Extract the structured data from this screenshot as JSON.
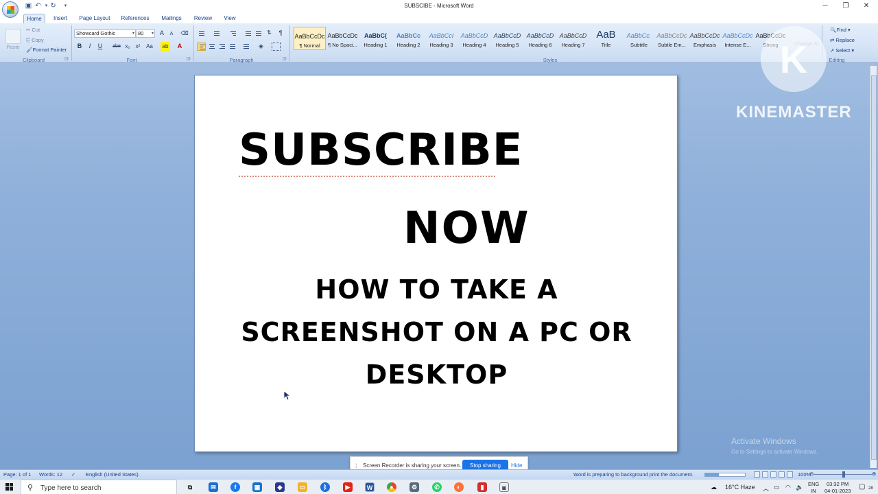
{
  "window": {
    "title": "SUBSCIBE - Microsoft Word",
    "minimize": "─",
    "maximize": "❐",
    "close": "✕"
  },
  "tabs": [
    "Home",
    "Insert",
    "Page Layout",
    "References",
    "Mailings",
    "Review",
    "View"
  ],
  "ribbon": {
    "clipboard": {
      "cut": "Cut",
      "copy": "Copy",
      "format_painter": "Format Painter",
      "paste": "Paste",
      "label": "Clipboard"
    },
    "font": {
      "name": "Showcard Gothic",
      "size": "80",
      "label": "Font",
      "bold": "B",
      "italic": "I",
      "underline": "U",
      "strike": "abe",
      "subscript": "x₂",
      "superscript": "x²",
      "change_case": "Aa",
      "grow": "A",
      "shrink": "A"
    },
    "paragraph": {
      "label": "Paragraph",
      "pilcrow": "¶"
    },
    "styles": {
      "label": "Styles",
      "items": [
        {
          "sample": "AaBbCcDc",
          "name": "¶ Normal"
        },
        {
          "sample": "AaBbCcDc",
          "name": "¶ No Spaci..."
        },
        {
          "sample": "AaBbC(",
          "name": "Heading 1"
        },
        {
          "sample": "AaBbCc",
          "name": "Heading 2"
        },
        {
          "sample": "AaBbCcI",
          "name": "Heading 3"
        },
        {
          "sample": "AaBbCcD",
          "name": "Heading 4"
        },
        {
          "sample": "AaBbCcD",
          "name": "Heading 5"
        },
        {
          "sample": "AaBbCcD",
          "name": "Heading 6"
        },
        {
          "sample": "AaBbCcD",
          "name": "Heading 7"
        },
        {
          "sample": "AaB",
          "name": "Title"
        },
        {
          "sample": "AaBbCc.",
          "name": "Subtitle"
        },
        {
          "sample": "AaBbCcDc",
          "name": "Subtle Em..."
        },
        {
          "sample": "AaBbCcDc",
          "name": "Emphasis"
        },
        {
          "sample": "AaBbCcDc",
          "name": "Intense E..."
        },
        {
          "sample": "AaBbCcDc",
          "name": "Strong"
        }
      ],
      "change_styles": "Change Styles"
    },
    "editing": {
      "label": "Editing",
      "find": "Find",
      "replace": "Replace",
      "select": "Select"
    }
  },
  "document": {
    "line1": "SUBSCRIBE",
    "line2": "NOW",
    "line3": "HOW TO TAKE A",
    "line4": "SCREENSHOT ON A PC OR",
    "line5": "DESKTOP"
  },
  "watermark": {
    "logo_letter": "K",
    "brand": "KINEMASTER"
  },
  "activate": {
    "title": "Activate Windows",
    "subtitle": "Go to Settings to activate Windows."
  },
  "share_bar": {
    "grip": "⁞",
    "message": "Screen Recorder is sharing your screen.",
    "stop": "Stop sharing",
    "hide": "Hide"
  },
  "status": {
    "page": "Page: 1 of 1",
    "words": "Words: 12",
    "language": "English (United States)",
    "message": "Word is preparing to background print the document.",
    "progress_fraction": 0.35,
    "zoom": "100%",
    "zoom_out": "⊖",
    "zoom_in": "⊕"
  },
  "taskbar": {
    "search_placeholder": "Type here to search",
    "weather": "16°C  Haze",
    "lang_top": "ENG",
    "lang_bottom": "IN",
    "time": "03:32 PM",
    "date": "04-01-2023",
    "notif_count": "28"
  }
}
